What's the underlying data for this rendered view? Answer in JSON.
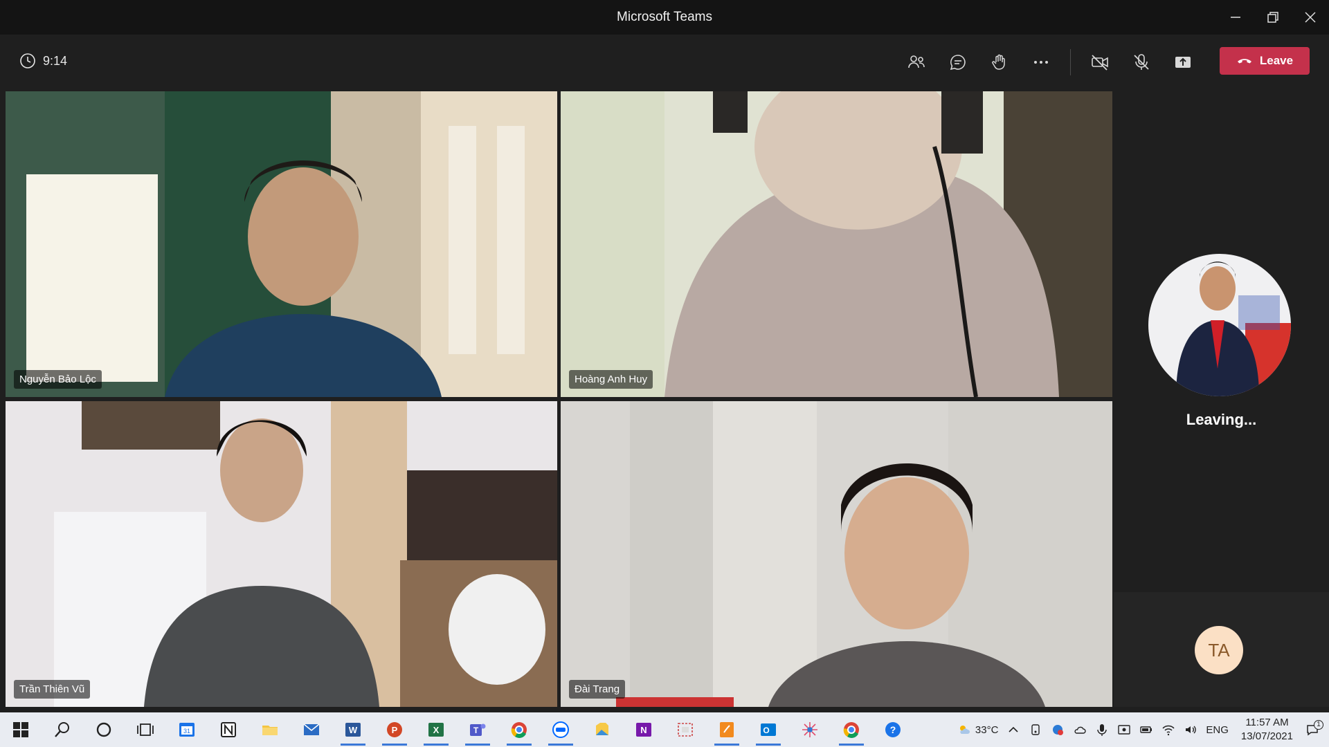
{
  "window": {
    "title": "Microsoft Teams"
  },
  "meeting": {
    "elapsed": "9:14",
    "leave_label": "Leave"
  },
  "participants": [
    {
      "name": "Nguyễn Bảo Lộc"
    },
    {
      "name": "Hoàng Anh Huy"
    },
    {
      "name": "Trần Thiên Vũ"
    },
    {
      "name": "Đài Trang"
    }
  ],
  "side": {
    "status": "Leaving...",
    "initials": "TA"
  },
  "taskbar": {
    "temperature": "33°C",
    "language": "ENG",
    "time": "11:57 AM",
    "date": "13/07/2021",
    "notification_count": "1"
  },
  "colors": {
    "leave": "#c4314b",
    "active_outline": "#9ea2ff",
    "initials_bg": "#fbe0c5"
  }
}
